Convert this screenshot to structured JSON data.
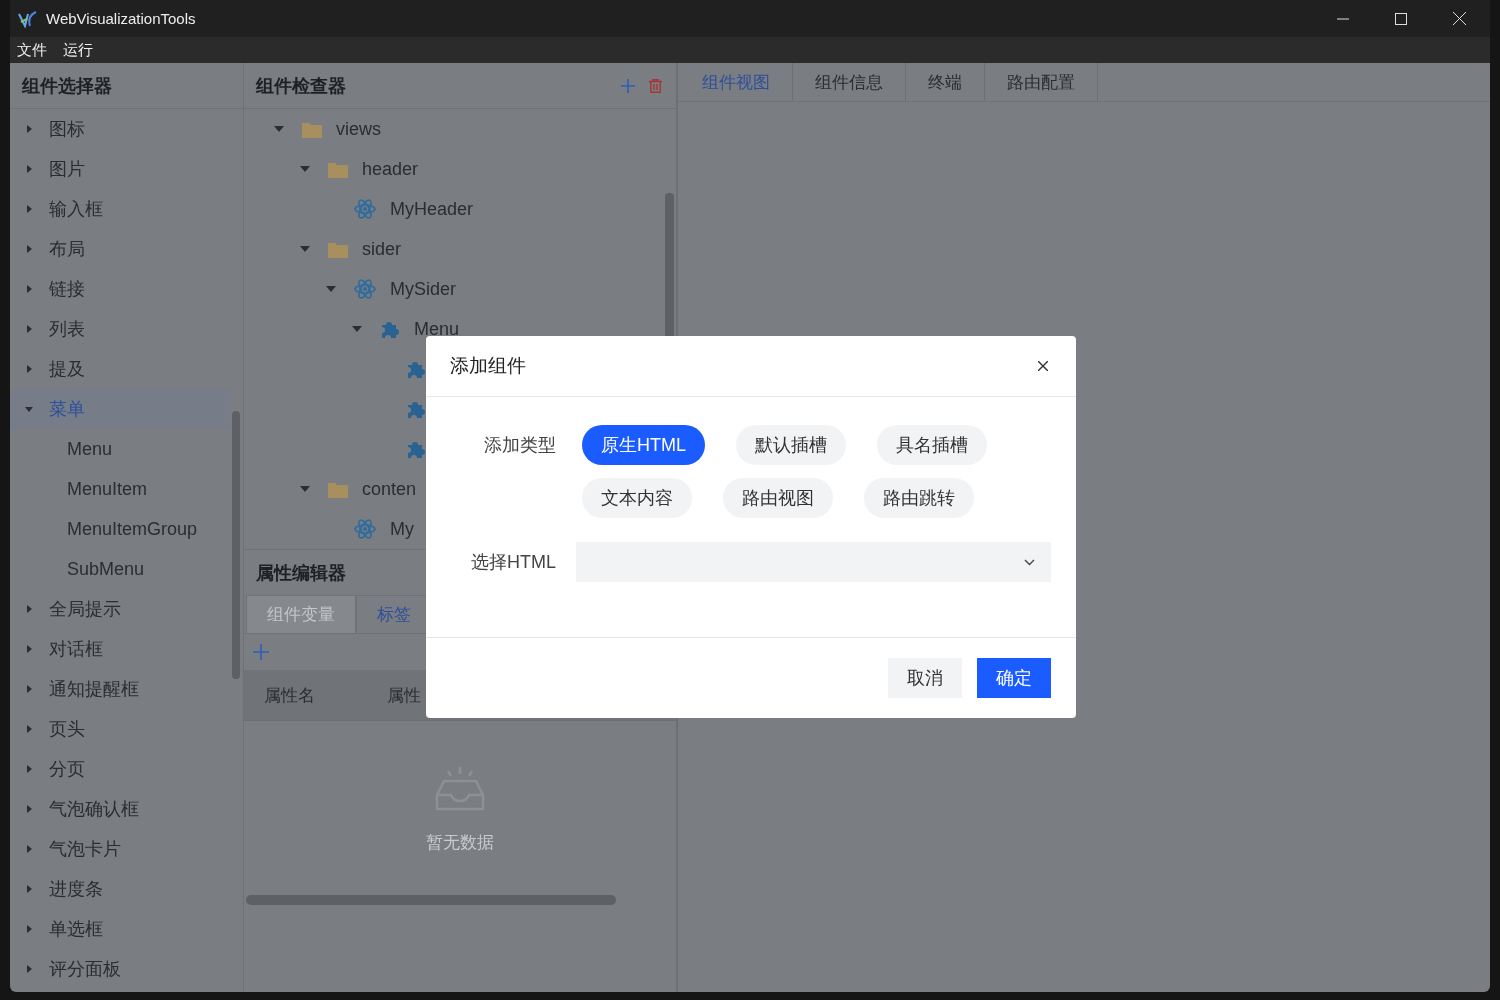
{
  "window": {
    "title": "WebVisualizationTools"
  },
  "menu": [
    "文件",
    "运行"
  ],
  "selector": {
    "title": "组件选择器",
    "items": [
      {
        "label": "图标",
        "expanded": false,
        "selected": false
      },
      {
        "label": "图片",
        "expanded": false,
        "selected": false
      },
      {
        "label": "输入框",
        "expanded": false,
        "selected": false
      },
      {
        "label": "布局",
        "expanded": false,
        "selected": false
      },
      {
        "label": "链接",
        "expanded": false,
        "selected": false
      },
      {
        "label": "列表",
        "expanded": false,
        "selected": false
      },
      {
        "label": "提及",
        "expanded": false,
        "selected": false
      },
      {
        "label": "菜单",
        "expanded": true,
        "selected": true,
        "children": [
          {
            "label": "Menu",
            "selected": false
          },
          {
            "label": "MenuItem",
            "selected": false
          },
          {
            "label": "MenuItemGroup",
            "selected": false
          },
          {
            "label": "SubMenu",
            "selected": false
          }
        ]
      },
      {
        "label": "全局提示",
        "expanded": false,
        "selected": false
      },
      {
        "label": "对话框",
        "expanded": false,
        "selected": false
      },
      {
        "label": "通知提醒框",
        "expanded": false,
        "selected": false
      },
      {
        "label": "页头",
        "expanded": false,
        "selected": false
      },
      {
        "label": "分页",
        "expanded": false,
        "selected": false
      },
      {
        "label": "气泡确认框",
        "expanded": false,
        "selected": false
      },
      {
        "label": "气泡卡片",
        "expanded": false,
        "selected": false
      },
      {
        "label": "进度条",
        "expanded": false,
        "selected": false
      },
      {
        "label": "单选框",
        "expanded": false,
        "selected": false
      },
      {
        "label": "评分面板",
        "expanded": false,
        "selected": false
      }
    ]
  },
  "inspector": {
    "title": "组件检查器",
    "tree": [
      {
        "label": "views",
        "kind": "folder",
        "expanded": true,
        "children": [
          {
            "label": "header",
            "kind": "folder",
            "expanded": true,
            "children": [
              {
                "label": "MyHeader",
                "kind": "vue"
              }
            ]
          },
          {
            "label": "sider",
            "kind": "folder",
            "expanded": true,
            "children": [
              {
                "label": "MySider",
                "kind": "vue",
                "expanded": true,
                "children": [
                  {
                    "label": "Menu",
                    "kind": "component",
                    "expanded": true,
                    "children": [
                      {
                        "kind": "component"
                      },
                      {
                        "kind": "component"
                      },
                      {
                        "kind": "component"
                      }
                    ]
                  }
                ]
              }
            ]
          },
          {
            "label": "conten",
            "kind": "folder",
            "expanded": true,
            "children": [
              {
                "label": "My",
                "kind": "vue"
              }
            ]
          }
        ]
      }
    ]
  },
  "property_editor": {
    "title": "属性编辑器",
    "tabs": [
      {
        "label": "组件变量",
        "selected": false,
        "disabled": true
      },
      {
        "label": "标签",
        "selected": true,
        "disabled": false
      }
    ],
    "columns": [
      "属性名",
      "属性"
    ],
    "empty_text": "暂无数据"
  },
  "view_tabs": [
    {
      "label": "组件视图",
      "selected": true
    },
    {
      "label": "组件信息",
      "selected": false
    },
    {
      "label": "终端",
      "selected": false
    },
    {
      "label": "路由配置",
      "selected": false
    }
  ],
  "dialog": {
    "title": "添加组件",
    "type_label": "添加类型",
    "types": [
      {
        "label": "原生HTML",
        "selected": true
      },
      {
        "label": "默认插槽",
        "selected": false
      },
      {
        "label": "具名插槽",
        "selected": false
      },
      {
        "label": "文本内容",
        "selected": false
      },
      {
        "label": "路由视图",
        "selected": false
      },
      {
        "label": "路由跳转",
        "selected": false
      }
    ],
    "select_label": "选择HTML",
    "buttons": [
      {
        "label": "取消",
        "kind": "secondary"
      },
      {
        "label": "确定",
        "kind": "primary"
      }
    ]
  }
}
